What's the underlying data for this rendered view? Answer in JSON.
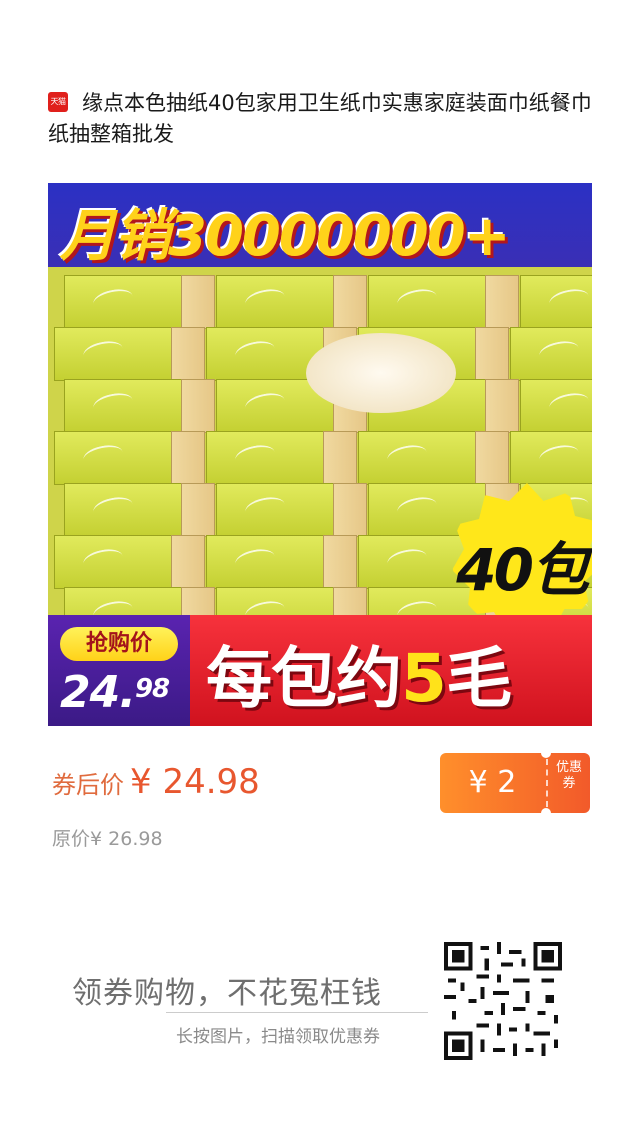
{
  "product": {
    "shop_badge": "天猫",
    "title": "缘点本色抽纸40包家用卫生纸巾实惠家庭装面巾纸餐巾纸抽整箱批发"
  },
  "banner": {
    "monthly_sales": "月销30000000+",
    "pack_count": "40包",
    "promo_label": "抢购价",
    "promo_price_int": "24.",
    "promo_price_dec": "98",
    "per_pack_prefix": "每包约",
    "per_pack_num": "5",
    "per_pack_suffix": "毛"
  },
  "pricing": {
    "after_coupon_label": "券后价",
    "after_coupon_value": "¥ 24.98",
    "original_label": "原价",
    "original_value": "¥  26.98"
  },
  "coupon": {
    "amount": "¥ 2",
    "label": "优惠券"
  },
  "footer": {
    "slogan": "领券购物，不花冤枉钱",
    "hint": "长按图片，扫描领取优惠券"
  }
}
